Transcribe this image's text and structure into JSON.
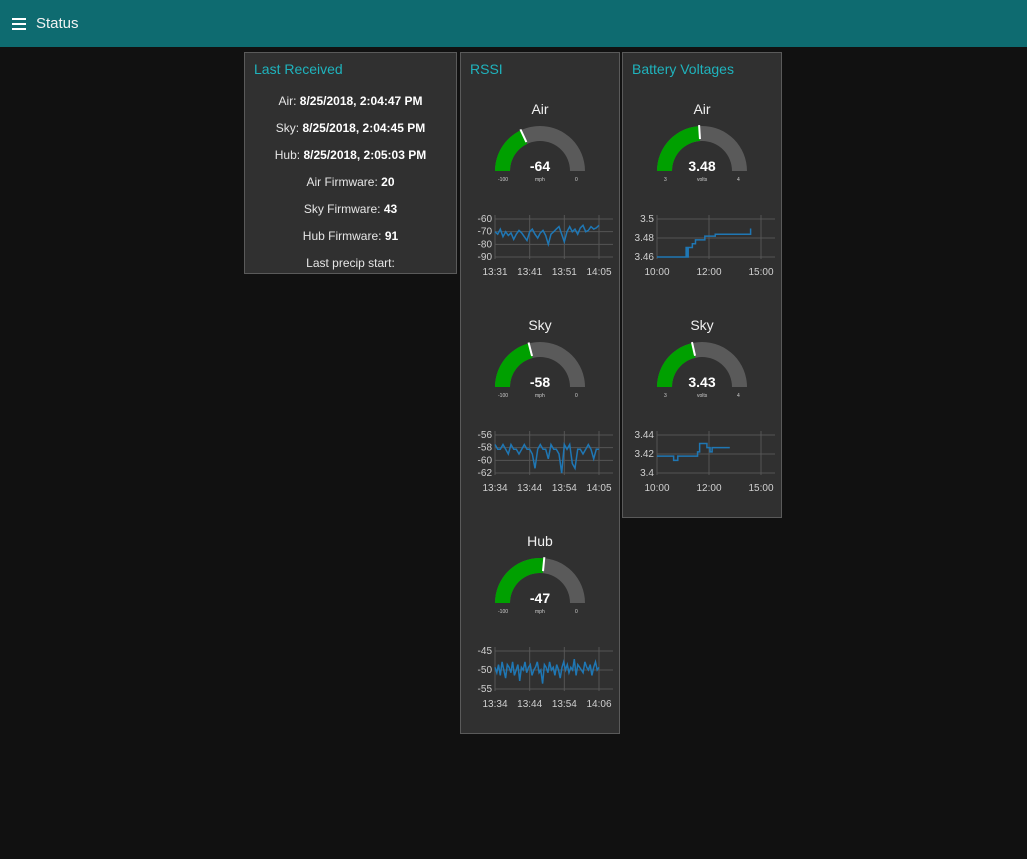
{
  "header": {
    "title": "Status",
    "menu_icon": "hamburger-menu-icon",
    "bg": "#0e6b70"
  },
  "last_received": {
    "title": "Last Received",
    "rows": [
      {
        "label": "Air:",
        "value": "8/25/2018, 2:04:47 PM"
      },
      {
        "label": "Sky:",
        "value": "8/25/2018, 2:04:45 PM"
      },
      {
        "label": "Hub:",
        "value": "8/25/2018, 2:05:03 PM"
      },
      {
        "label": "Air Firmware:",
        "value": "20"
      },
      {
        "label": "Sky Firmware:",
        "value": "43"
      },
      {
        "label": "Hub Firmware:",
        "value": "91"
      },
      {
        "label": "Last precip start:",
        "value": ""
      }
    ]
  },
  "rssi": {
    "title": "RSSI",
    "gauges": [
      {
        "title": "Air",
        "value": "-64",
        "min": "-100",
        "max": "0",
        "units": "mph",
        "fraction": 0.36
      },
      {
        "title": "Sky",
        "value": "-58",
        "min": "-100",
        "max": "0",
        "units": "mph",
        "fraction": 0.42
      },
      {
        "title": "Hub",
        "value": "-47",
        "min": "-100",
        "max": "0",
        "units": "mph",
        "fraction": 0.53
      }
    ]
  },
  "battery": {
    "title": "Battery Voltages",
    "gauges": [
      {
        "title": "Air",
        "value": "3.48",
        "min": "3",
        "max": "4",
        "units": "volts",
        "fraction": 0.48
      },
      {
        "title": "Sky",
        "value": "3.43",
        "min": "3",
        "max": "4",
        "units": "volts",
        "fraction": 0.43
      }
    ]
  },
  "colors": {
    "gauge_fill": "#00a000",
    "gauge_track": "#5a5a5a",
    "line": "#1f77b4",
    "grid": "#555555",
    "accent": "#1fb3bd"
  },
  "chart_data": [
    {
      "type": "line",
      "name": "rssi-air",
      "x_ticks": [
        "13:31",
        "13:41",
        "13:51",
        "14:05"
      ],
      "y_ticks": [
        "-60",
        "-70",
        "-80",
        "-90"
      ],
      "ylim": [
        -90,
        -60
      ],
      "values": [
        -70,
        -72,
        -68,
        -74,
        -70,
        -73,
        -71,
        -76,
        -72,
        -69,
        -71,
        -74,
        -77,
        -70,
        -68,
        -72,
        -75,
        -71,
        -69,
        -73,
        -80,
        -72,
        -70,
        -68,
        -66,
        -72,
        -78,
        -70,
        -66,
        -70,
        -68,
        -72,
        -67,
        -65,
        -70,
        -69,
        -66,
        -68,
        -67,
        -65
      ]
    },
    {
      "type": "line",
      "name": "battery-air",
      "x_ticks": [
        "10:00",
        "12:00",
        "15:00"
      ],
      "y_ticks": [
        "3.5",
        "3.48",
        "3.46"
      ],
      "ylim": [
        3.46,
        3.5
      ],
      "x": [
        0,
        0.27,
        0.28,
        0.29,
        0.3,
        0.33,
        0.34,
        0.36,
        0.37,
        0.4,
        0.41,
        0.45,
        0.46,
        0.55,
        0.56,
        0.9
      ],
      "values": [
        3.46,
        3.46,
        3.47,
        3.46,
        3.47,
        3.47,
        3.474,
        3.474,
        3.478,
        3.478,
        3.478,
        3.478,
        3.482,
        3.482,
        3.484,
        3.49
      ]
    },
    {
      "type": "line",
      "name": "rssi-sky",
      "x_ticks": [
        "13:34",
        "13:44",
        "13:54",
        "14:05"
      ],
      "y_ticks": [
        "-56",
        "-58",
        "-60",
        "-62"
      ],
      "ylim": [
        -63,
        -55
      ],
      "values": [
        -57,
        -58,
        -58,
        -57,
        -58,
        -59,
        -57,
        -58,
        -58,
        -59,
        -58,
        -57,
        -58,
        -58,
        -59,
        -62,
        -58,
        -57,
        -58,
        -58,
        -60,
        -57,
        -58,
        -58,
        -59,
        -63,
        -57,
        -58,
        -57,
        -61,
        -62,
        -58,
        -58,
        -59,
        -58,
        -57,
        -58,
        -60,
        -58,
        -58
      ]
    },
    {
      "type": "line",
      "name": "battery-sky",
      "x_ticks": [
        "10:00",
        "12:00",
        "15:00"
      ],
      "y_ticks": [
        "3.44",
        "3.42",
        "3.4"
      ],
      "ylim": [
        3.4,
        3.445
      ],
      "x": [
        0,
        0.15,
        0.16,
        0.19,
        0.2,
        0.38,
        0.39,
        0.4,
        0.41,
        0.47,
        0.48,
        0.5,
        0.51,
        0.52,
        0.53,
        0.56,
        0.57,
        0.7
      ],
      "values": [
        3.42,
        3.42,
        3.415,
        3.415,
        3.42,
        3.42,
        3.425,
        3.425,
        3.435,
        3.435,
        3.43,
        3.43,
        3.425,
        3.425,
        3.43,
        3.43,
        3.43,
        3.43
      ]
    },
    {
      "type": "line",
      "name": "rssi-hub",
      "x_ticks": [
        "13:34",
        "13:44",
        "13:54",
        "14:06"
      ],
      "y_ticks": [
        "-45",
        "-50",
        "-55"
      ],
      "ylim": [
        -57,
        -43
      ],
      "values": [
        -49,
        -51,
        -48,
        -52,
        -47,
        -50,
        -53,
        -48,
        -49,
        -51,
        -47,
        -52,
        -50,
        -48,
        -54,
        -49,
        -50,
        -47,
        -51,
        -49,
        -48,
        -52,
        -50,
        -49,
        -47,
        -51,
        -50,
        -55,
        -48,
        -49,
        -51,
        -47,
        -50,
        -49,
        -52,
        -48,
        -50,
        -53,
        -49,
        -47,
        -50,
        -48,
        -51,
        -49,
        -50,
        -46,
        -52,
        -48,
        -49,
        -50,
        -51,
        -47,
        -49,
        -50,
        -48,
        -52,
        -49,
        -47,
        -50,
        -49
      ]
    }
  ]
}
